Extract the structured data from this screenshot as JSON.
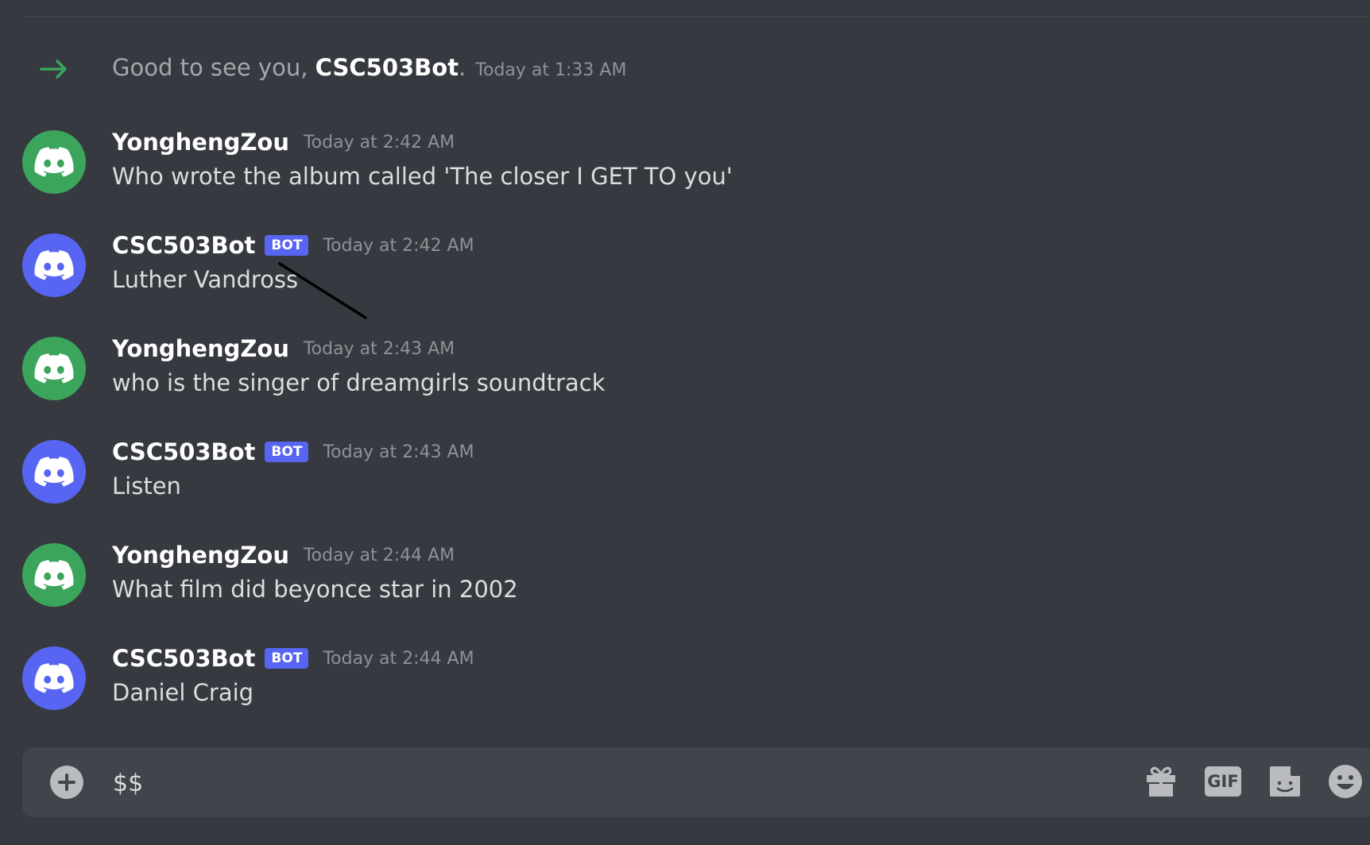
{
  "join": {
    "prefix": "Good to see you, ",
    "name": "CSC503Bot",
    "suffix": ".",
    "timestamp": "Today at 1:33 AM"
  },
  "messages": [
    {
      "author": "YonghengZou",
      "bot": false,
      "timestamp": "Today at 2:42 AM",
      "text": "Who wrote the album called 'The closer I GET TO you'"
    },
    {
      "author": "CSC503Bot",
      "bot": true,
      "bot_label": "BOT",
      "timestamp": "Today at 2:42 AM",
      "text": "Luther Vandross"
    },
    {
      "author": "YonghengZou",
      "bot": false,
      "timestamp": "Today at 2:43 AM",
      "text": "who is the singer of dreamgirls soundtrack"
    },
    {
      "author": "CSC503Bot",
      "bot": true,
      "bot_label": "BOT",
      "timestamp": "Today at 2:43 AM",
      "text": "Listen"
    },
    {
      "author": "YonghengZou",
      "bot": false,
      "timestamp": "Today at 2:44 AM",
      "text": "What film did beyonce star in 2002"
    },
    {
      "author": "CSC503Bot",
      "bot": true,
      "bot_label": "BOT",
      "timestamp": "Today at 2:44 AM",
      "text": "Daniel Craig"
    }
  ],
  "composer": {
    "value": "$$",
    "gif_label": "GIF"
  },
  "colors": {
    "background": "#36393f",
    "composer": "#40444b",
    "user_avatar": "#3ba55c",
    "bot_avatar": "#5865f2",
    "bot_tag": "#5865f2",
    "join_arrow": "#3ba55c"
  },
  "icons": {
    "join": "arrow-right-icon",
    "avatar": "discord-logo-icon",
    "add": "plus-circle-icon",
    "gift": "gift-icon",
    "gif": "gif-icon",
    "sticker": "sticker-icon",
    "emoji": "emoji-icon"
  }
}
